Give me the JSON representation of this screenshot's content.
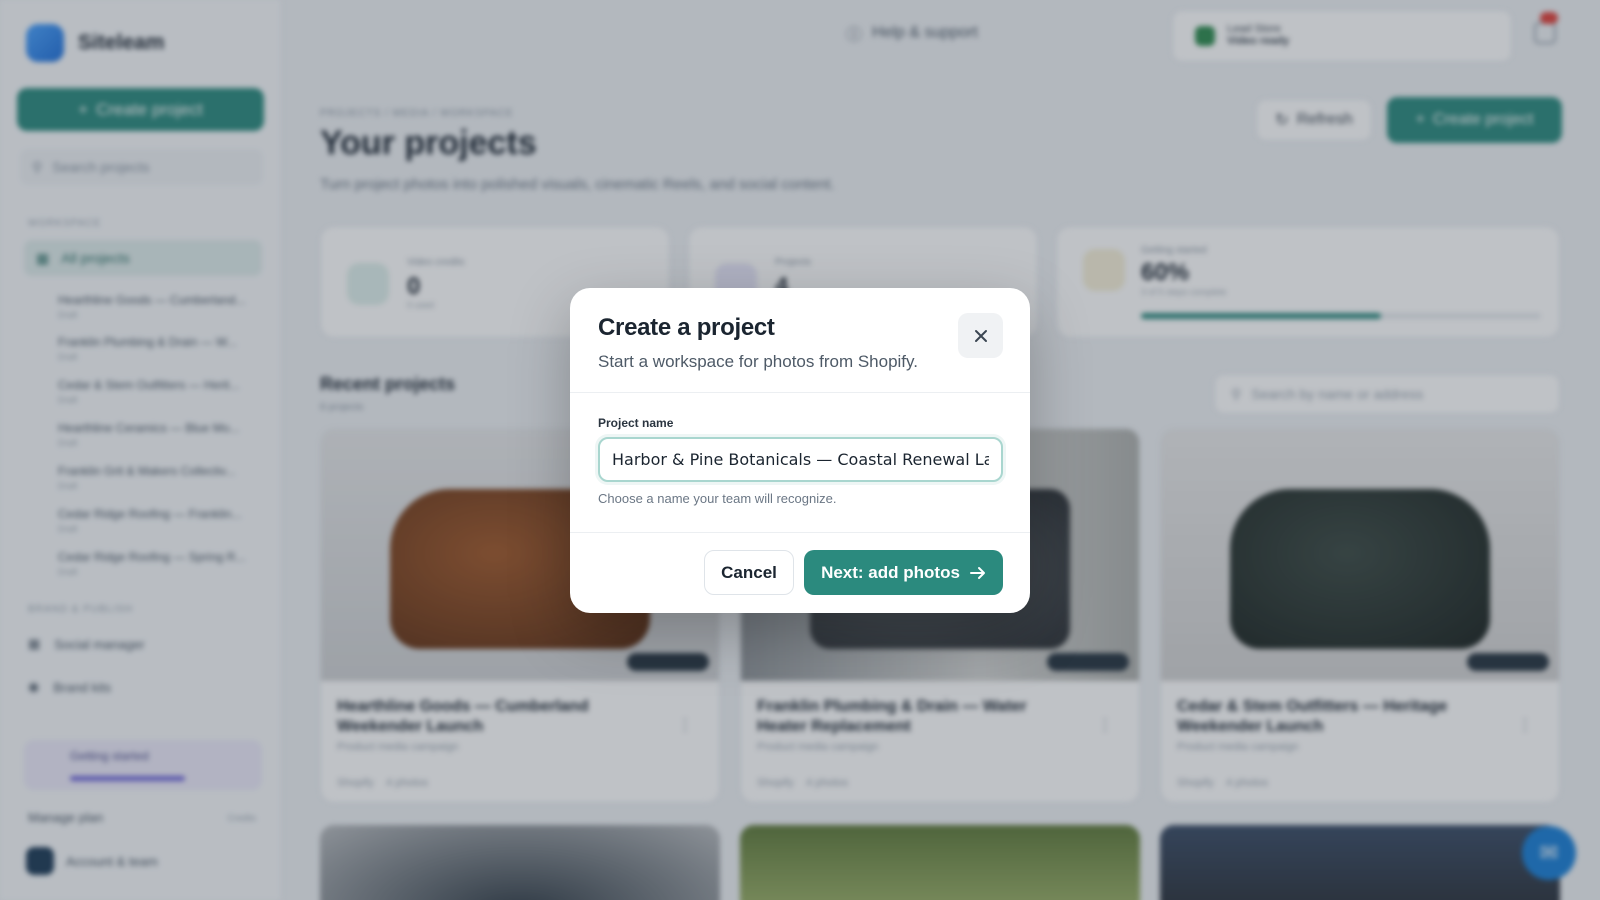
{
  "app": {
    "brand": "Siteleam",
    "sidebar": {
      "create_label": "Create project",
      "search_placeholder": "Search projects",
      "section_workspace": "Workspace",
      "all_projects": "All projects",
      "projects": [
        {
          "name": "Hearthline Goods — Cumberland...",
          "meta": "Draft"
        },
        {
          "name": "Franklin Plumbing & Drain — W...",
          "meta": "Draft"
        },
        {
          "name": "Cedar & Stem Outfitters — Herit...",
          "meta": "Draft"
        },
        {
          "name": "Hearthline Ceramics — Blue Mo...",
          "meta": "Draft"
        },
        {
          "name": "Franklin Grit & Makers Collectiv...",
          "meta": "Draft"
        },
        {
          "name": "Cedar Ridge Roofing — Franklin...",
          "meta": "Draft"
        },
        {
          "name": "Cedar Ridge Roofing — Spring R...",
          "meta": "Draft"
        }
      ],
      "section_brand": "Brand & publish",
      "social_manager": "Social manager",
      "brand_kits": "Brand kits",
      "credits_label": "Getting started",
      "manage_plan": "Manage plan",
      "manage_plan_badge": "Credits",
      "account": "Account & team"
    },
    "topbar": {
      "help": "Help & support",
      "user_line1": "Lead Store",
      "user_line2": "Video ready"
    },
    "main": {
      "breadcrumb": "Projects / Media / Workspace",
      "title": "Your projects",
      "subtitle": "Turn project photos into polished visuals, cinematic Reels, and social content.",
      "refresh_label": "Refresh",
      "create_label": "Create project",
      "stats": [
        {
          "label": "Video credits",
          "value": "0",
          "foot": "0 used"
        },
        {
          "label": "Projects",
          "value": "4",
          "foot": ""
        },
        {
          "label": "Getting started",
          "value": "60%",
          "foot": "3 of 5 steps complete",
          "progress": 0.6
        }
      ],
      "recent_title": "Recent projects",
      "recent_sub": "8 projects",
      "recent_search_placeholder": "Search by name or address",
      "cards": [
        {
          "title": "Hearthline Goods — Cumberland Weekender Launch",
          "meta": "Product media campaign",
          "foot_a": "Shopify",
          "foot_b": "4 photos"
        },
        {
          "title": "Franklin Plumbing & Drain — Water Heater Replacement",
          "meta": "Product media campaign",
          "foot_a": "Shopify",
          "foot_b": "4 photos"
        },
        {
          "title": "Cedar & Stem Outfitters — Heritage Weekender Launch",
          "meta": "Product media campaign",
          "foot_a": "Shopify",
          "foot_b": "4 photos"
        }
      ]
    }
  },
  "modal": {
    "title": "Create a project",
    "subtitle": "Start a workspace for photos from Shopify.",
    "field_label": "Project name",
    "field_value": "Harbor & Pine Botanicals — Coastal Renewal Launch",
    "help_text": "Choose a name your team will recognize.",
    "cancel_label": "Cancel",
    "next_label": "Next: add photos"
  },
  "colors": {
    "accent": "#2b8a7e",
    "scrim": "#2a3642",
    "chat": "#1a7fd6"
  }
}
